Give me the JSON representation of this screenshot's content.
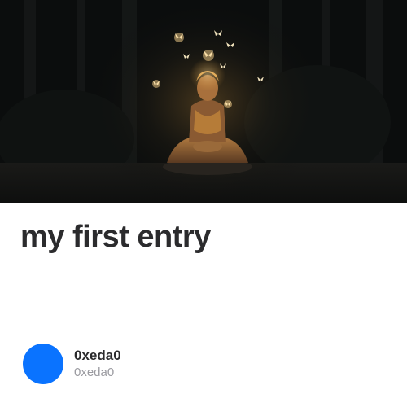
{
  "entry": {
    "cover_image": "meditating-deity-with-glowing-butterflies",
    "title": "my first entry"
  },
  "author": {
    "avatar_color": "#0a73ff",
    "name": "0xeda0",
    "handle": "0xeda0"
  }
}
